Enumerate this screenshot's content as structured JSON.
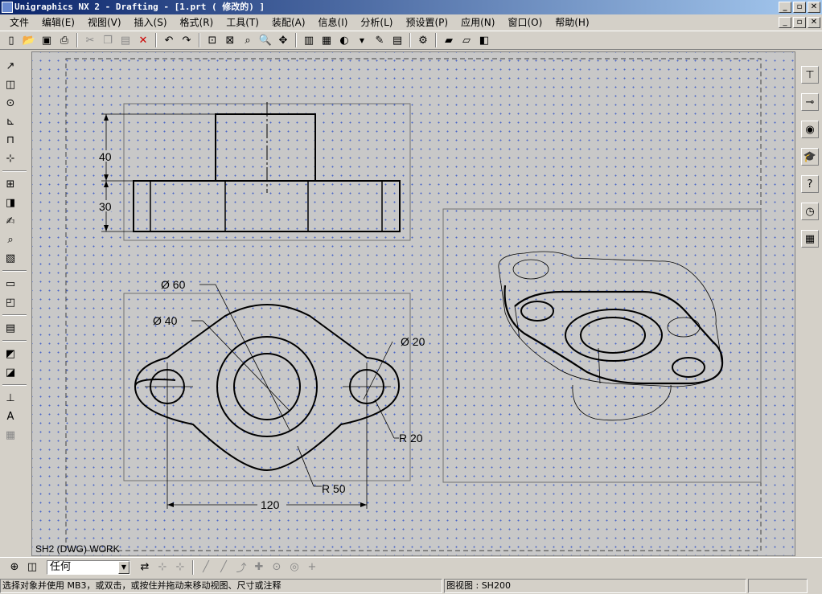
{
  "window": {
    "title": "Unigraphics NX 2 - Drafting - [1.prt ( 修改的) ]"
  },
  "menu": {
    "items": [
      "文件",
      "编辑(E)",
      "视图(V)",
      "插入(S)",
      "格式(R)",
      "工具(T)",
      "装配(A)",
      "信息(I)",
      "分析(L)",
      "预设置(P)",
      "应用(N)",
      "窗口(O)",
      "帮助(H)"
    ]
  },
  "drawing": {
    "sheet_label": "SH2 (DWG) WORK",
    "front_view": {
      "dim_height_top": "40",
      "dim_height_bottom": "30"
    },
    "top_view": {
      "dia_outer": "Ø 60",
      "dia_inner": "Ø 40",
      "dia_hole": "Ø 20",
      "radius_small": "R 20",
      "radius_large": "R 50",
      "width": "120"
    }
  },
  "bottom_toolbar": {
    "filter_value": "任何"
  },
  "status": {
    "prompt": "选择对象并使用 MB3，或双击，或按住并拖动来移动视图、尺寸或注释",
    "view_info": "图视图 : SH200"
  },
  "colors": {
    "title_start": "#0a246a",
    "title_end": "#a6caf0",
    "grid_dot": "#4a66c8",
    "canvas": "#c8c8c8"
  }
}
